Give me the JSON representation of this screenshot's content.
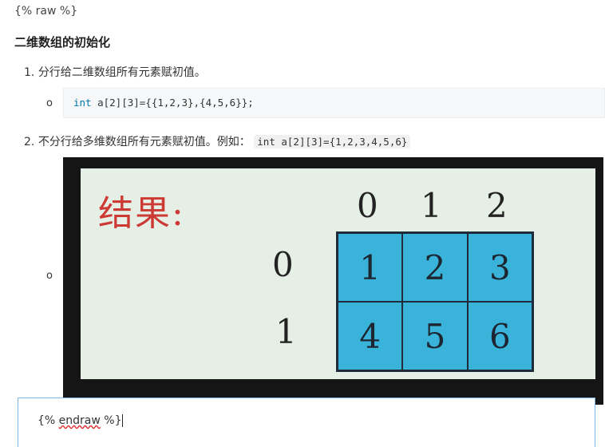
{
  "raw_open": "{% raw %}",
  "heading": "二维数组的初始化",
  "item1": {
    "marker": "1.",
    "text": "分行给二维数组所有元素赋初值。"
  },
  "bullet_glyph": "o",
  "code1": {
    "keyword": "int",
    "rest": " a[2][3]={{1,2,3},{4,5,6}};"
  },
  "item2": {
    "marker": "2.",
    "text": "不分行给多维数组所有元素赋初值。例如：",
    "code": "int a[2][3]={1,2,3,4,5,6}"
  },
  "image": {
    "label": "结果:",
    "col_headers": [
      "0",
      "1",
      "2"
    ],
    "row_headers": [
      "0",
      "1"
    ],
    "cells": [
      [
        "1",
        "2",
        "3"
      ],
      [
        "4",
        "5",
        "6"
      ]
    ],
    "colors": {
      "board": "#e6efe6",
      "cell": "#3ab3db",
      "label": "#cc3a33"
    }
  },
  "editor": {
    "text_prefix": "{% ",
    "text_word": "endraw",
    "text_suffix": " %}"
  }
}
